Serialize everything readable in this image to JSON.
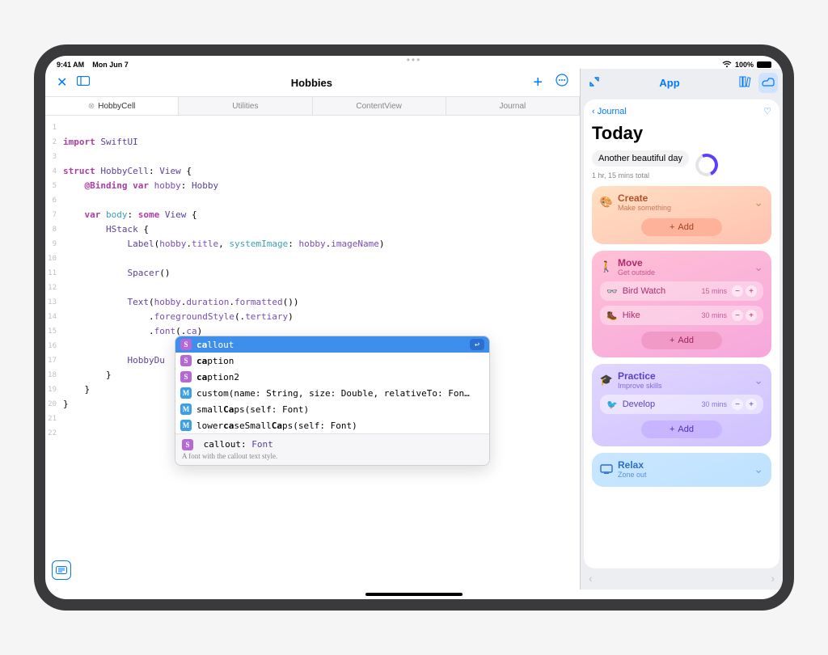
{
  "statusbar": {
    "time": "9:41 AM",
    "date": "Mon Jun 7",
    "battery": "100%"
  },
  "toolbar": {
    "title": "Hobbies"
  },
  "tabs": [
    "HobbyCell",
    "Utilities",
    "ContentView",
    "Journal"
  ],
  "code": {
    "lines": [
      "",
      "import SwiftUI",
      "",
      "struct HobbyCell: View {",
      "    @Binding var hobby: Hobby",
      "",
      "    var body: some View {",
      "        HStack {",
      "            Label(hobby.title, systemImage: hobby.imageName)",
      "",
      "            Spacer()",
      "",
      "            Text(hobby.duration.formatted())",
      "                .foregroundStyle(.tertiary)",
      "                .font(.ca)",
      "",
      "            HobbyDu",
      "        }",
      "    }",
      "}",
      "",
      ""
    ]
  },
  "autocomplete": {
    "items": [
      {
        "badge": "S",
        "label_pre": "ca",
        "label_rest": "llout",
        "selected": true
      },
      {
        "badge": "S",
        "label_pre": "ca",
        "label_rest": "ption"
      },
      {
        "badge": "S",
        "label_pre": "ca",
        "label_rest": "ption2"
      },
      {
        "badge": "M",
        "label_full": "custom(name: String, size: Double, relativeTo: Fon…"
      },
      {
        "badge": "M",
        "label_full": "smallCaps(self: Font)"
      },
      {
        "badge": "M",
        "label_full": "lowercaseSmallCaps(self: Font)"
      }
    ],
    "footer": {
      "sig_name": "callout",
      "sig_type": "Font",
      "doc": "A font with the callout text style."
    }
  },
  "right": {
    "title": "App",
    "back": "Journal",
    "heading": "Today",
    "summary": {
      "text": "Another beautiful day",
      "total": "1 hr, 15 mins total"
    },
    "create": {
      "title": "Create",
      "sub": "Make something",
      "add": "Add"
    },
    "move": {
      "title": "Move",
      "sub": "Get outside",
      "add": "Add",
      "rows": [
        {
          "icon": "bird",
          "label": "Bird Watch",
          "dur": "15 mins"
        },
        {
          "icon": "hike",
          "label": "Hike",
          "dur": "30 mins"
        }
      ]
    },
    "practice": {
      "title": "Practice",
      "sub": "Improve skills",
      "add": "Add",
      "rows": [
        {
          "icon": "swift",
          "label": "Develop",
          "dur": "30 mins"
        }
      ]
    },
    "relax": {
      "title": "Relax",
      "sub": "Zone out"
    }
  }
}
